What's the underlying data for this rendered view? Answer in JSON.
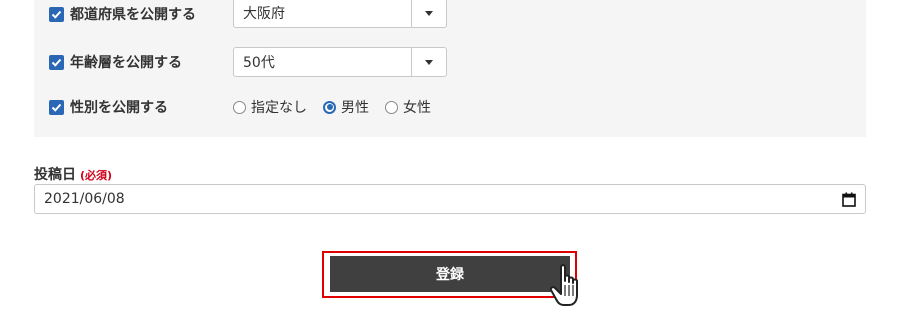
{
  "settings": {
    "prefecture": {
      "label": "都道府県を公開する",
      "checked": true,
      "value": "大阪府"
    },
    "age": {
      "label": "年齢層を公開する",
      "checked": true,
      "value": "50代"
    },
    "gender": {
      "label": "性別を公開する",
      "checked": true,
      "options": [
        "指定なし",
        "男性",
        "女性"
      ],
      "selected": "男性"
    }
  },
  "post_date": {
    "label": "投稿日",
    "required": "(必須)",
    "value": "2021/06/08"
  },
  "submit": {
    "label": "登録"
  },
  "colors": {
    "accent": "#2a68b5",
    "required": "#d0021b",
    "button": "#404040",
    "highlight": "#e00000"
  }
}
